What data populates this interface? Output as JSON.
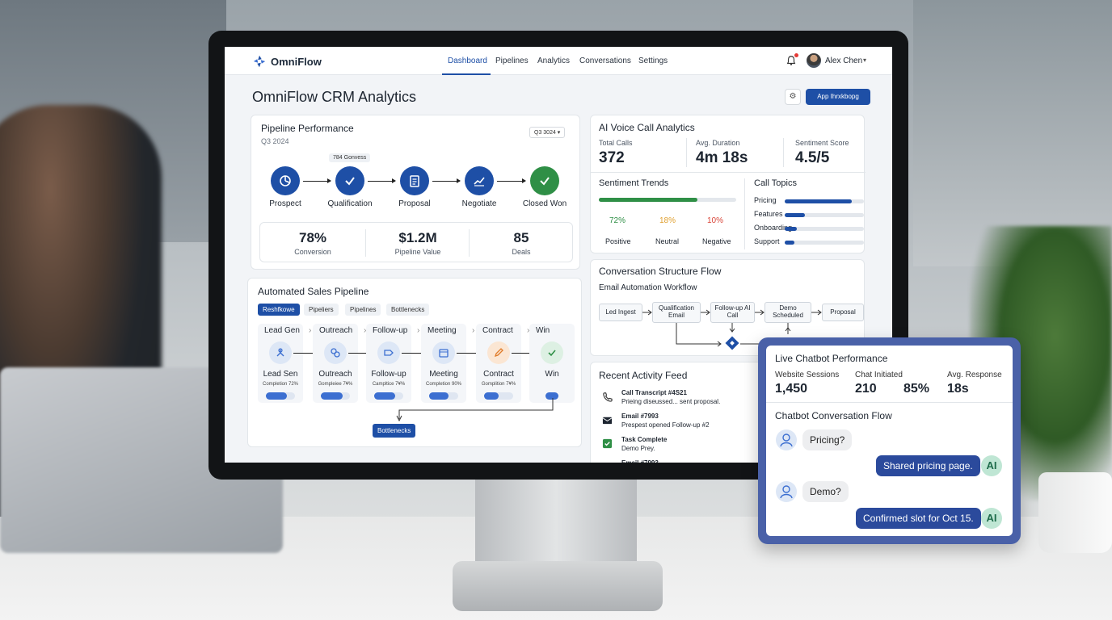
{
  "app": {
    "name": "OmniFlow"
  },
  "nav": {
    "items": [
      "Dashboard",
      "Pipelines",
      "Analytics",
      "Conversations",
      "Settings"
    ],
    "active": "Dashboard"
  },
  "user": {
    "name": "Alex Chen"
  },
  "page": {
    "title": "OmniFlow CRM Analytics",
    "action_button": "App Ihrxkbopg"
  },
  "pipeline_performance": {
    "title": "Pipeline Performance",
    "period": "Q3 2024",
    "dropdown": "Q3 3024",
    "tag": "784 Gonvess",
    "stages": [
      "Prospect",
      "Qualification",
      "Proposal",
      "Negotiate",
      "Closed Won"
    ],
    "stats": [
      {
        "value": "78%",
        "label": "Conversion"
      },
      {
        "value": "$1.2M",
        "label": "Pipeline Value"
      },
      {
        "value": "85",
        "label": "Deals"
      }
    ]
  },
  "automated_pipeline": {
    "title": "Automated Sales Pipeline",
    "tabs": [
      "Reshfkowe",
      "Pipeliers",
      "Pipelines",
      "Bottlenecks"
    ],
    "header_steps": [
      "Lead Gen",
      "Outreach",
      "Follow-up",
      "Meeting",
      "Contract",
      "Win"
    ],
    "steps": [
      {
        "label": "Lead Sen",
        "caption": "Completion 72%",
        "progress": 0.72
      },
      {
        "label": "Outreach",
        "caption": "Gompleiee 7¥%",
        "progress": 0.75
      },
      {
        "label": "Follow-up",
        "caption": "Campltice 7¥%",
        "progress": 0.72
      },
      {
        "label": "Meeting",
        "caption": "Completion 90%",
        "progress": 0.68
      },
      {
        "label": "Contract",
        "caption": "Gomplition 7¥%",
        "progress": 0.5
      },
      {
        "label": "Win",
        "caption": "",
        "progress": 0.2
      }
    ],
    "bottleneck_button": "Bottlenecks"
  },
  "voice_analytics": {
    "title": "AI Voice Call Analytics",
    "metrics": [
      {
        "label": "Total Calls",
        "value": "372"
      },
      {
        "label": "Avg. Duration",
        "value": "4m 18s"
      },
      {
        "label": "Sentiment Score",
        "value": "4.5/5"
      }
    ],
    "sentiment": {
      "title": "Sentiment Trends",
      "items": [
        {
          "pct": "72%",
          "label": "Positive",
          "color": "#2f8f46"
        },
        {
          "pct": "18%",
          "label": "Neutral",
          "color": "#e0a030"
        },
        {
          "pct": "10%",
          "label": "Negative",
          "color": "#d9463a"
        }
      ],
      "bar_fill": 0.72
    },
    "topics": {
      "title": "Call Topics",
      "items": [
        {
          "label": "Pricing",
          "value": 0.85
        },
        {
          "label": "Features",
          "value": 0.25
        },
        {
          "label": "Onboarding",
          "value": 0.15
        },
        {
          "label": "Support",
          "value": 0.12
        }
      ]
    }
  },
  "conversation_flow": {
    "title": "Conversation Structure Flow",
    "subtitle": "Email Automation Workflow",
    "nodes": [
      "Led Ingest",
      "Qualification Email",
      "Follow-up AI Call",
      "Demo Scheduled",
      "Proposal"
    ]
  },
  "activity_feed": {
    "title": "Recent Activity Feed",
    "items": [
      {
        "icon": "phone-icon",
        "title": "Call Transcript #4S21",
        "desc": "Prieing diseussed... sent proposal."
      },
      {
        "icon": "mail-icon",
        "title": "Email #7993",
        "desc": "Prespest opened Follow-up #2"
      },
      {
        "icon": "check-icon",
        "title": "Task Complete",
        "desc": "Demo Prey."
      },
      {
        "icon": "mail-icon",
        "title": "Email #7993",
        "desc": ""
      }
    ]
  },
  "chatbot": {
    "title": "Live Chatbot Performance",
    "metrics": [
      {
        "label": "Website Sessions",
        "value": "1,450"
      },
      {
        "label": "Chat Initiated",
        "value": "210"
      },
      {
        "label": "",
        "value": "85%"
      },
      {
        "label": "Avg. Response",
        "value": "18s"
      }
    ],
    "flow_title": "Chatbot Conversation Flow",
    "messages": [
      {
        "from": "user",
        "text": "Pricing?"
      },
      {
        "from": "ai",
        "text": "Shared pricing page.",
        "badge": "AI"
      },
      {
        "from": "user",
        "text": "Demo?"
      },
      {
        "from": "ai",
        "text": "Confirmed slot for Oct 15.",
        "badge": "AI"
      }
    ]
  },
  "colors": {
    "brand": "#1e4fa6",
    "success": "#2f8f46",
    "warning": "#e0a030",
    "danger": "#d9463a"
  }
}
